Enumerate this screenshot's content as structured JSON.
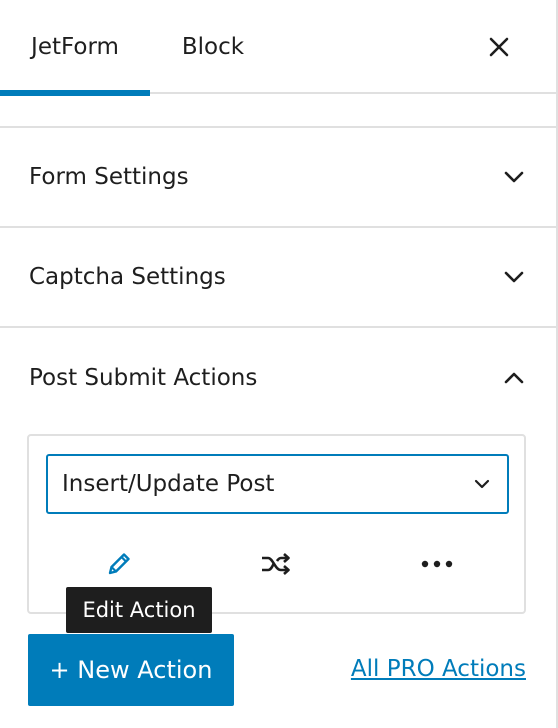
{
  "tabs": [
    {
      "label": "JetForm",
      "active": true
    },
    {
      "label": "Block",
      "active": false
    }
  ],
  "close_icon": "close-icon",
  "sections": {
    "form_settings": {
      "title": "Form Settings",
      "expanded": false,
      "icon": "chevron-down-icon"
    },
    "captcha_settings": {
      "title": "Captcha Settings",
      "expanded": false,
      "icon": "chevron-down-icon"
    },
    "post_submit_actions": {
      "title": "Post Submit Actions",
      "expanded": true,
      "icon": "chevron-up-icon"
    }
  },
  "action": {
    "selected": "Insert/Update Post",
    "icons": [
      "pencil-icon",
      "shuffle-icon",
      "more-icon"
    ],
    "tooltip": "Edit Action"
  },
  "footer": {
    "new_action_label": "+ New Action",
    "pro_link_label": "All PRO Actions"
  },
  "colors": {
    "accent": "#007cba",
    "tooltip_bg": "#1e1e1e",
    "border": "#e0e0e0"
  }
}
